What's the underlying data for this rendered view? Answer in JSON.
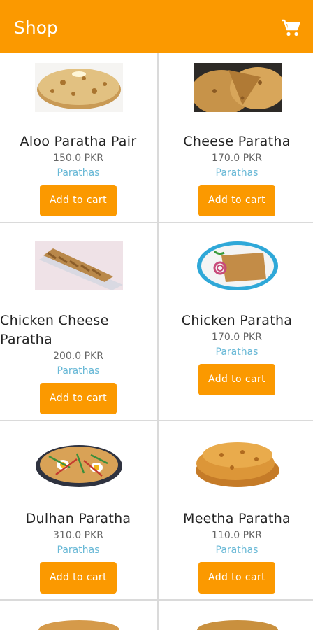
{
  "app": {
    "title": "Shop",
    "cart_icon": "shopping-cart-icon"
  },
  "colors": {
    "accent": "#fb9900",
    "category": "#68b8d6"
  },
  "products": [
    {
      "name": "Aloo Paratha Pair",
      "price": "150.0 PKR",
      "category": "Parathas",
      "button": "Add to cart"
    },
    {
      "name": "Cheese Paratha",
      "price": "170.0 PKR",
      "category": "Parathas",
      "button": "Add to cart"
    },
    {
      "name": "Chicken Cheese Paratha",
      "price": "200.0 PKR",
      "category": "Parathas",
      "button": "Add to cart"
    },
    {
      "name": "Chicken Paratha",
      "price": "170.0 PKR",
      "category": "Parathas",
      "button": "Add to cart"
    },
    {
      "name": "Dulhan Paratha",
      "price": "310.0 PKR",
      "category": "Parathas",
      "button": "Add to cart"
    },
    {
      "name": "Meetha Paratha",
      "price": "110.0 PKR",
      "category": "Parathas",
      "button": "Add to cart"
    }
  ]
}
